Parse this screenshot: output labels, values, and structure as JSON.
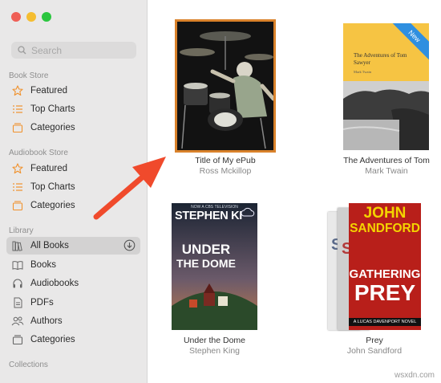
{
  "window": {
    "traffic_colors": [
      "#ef5f56",
      "#f5bd30",
      "#2bc63f"
    ]
  },
  "search": {
    "placeholder": "Search"
  },
  "sidebar": {
    "book_store": {
      "heading": "Book Store",
      "items": [
        {
          "label": "Featured",
          "icon": "star-icon"
        },
        {
          "label": "Top Charts",
          "icon": "list-icon"
        },
        {
          "label": "Categories",
          "icon": "shelf-box-icon"
        }
      ]
    },
    "audiobook_store": {
      "heading": "Audiobook Store",
      "items": [
        {
          "label": "Featured",
          "icon": "star-icon"
        },
        {
          "label": "Top Charts",
          "icon": "list-icon"
        },
        {
          "label": "Categories",
          "icon": "shelf-box-icon"
        }
      ]
    },
    "library": {
      "heading": "Library",
      "items": [
        {
          "label": "All Books",
          "icon": "books-icon",
          "selected": true
        },
        {
          "label": "Books",
          "icon": "open-book-icon"
        },
        {
          "label": "Audiobooks",
          "icon": "headphones-icon"
        },
        {
          "label": "PDFs",
          "icon": "document-icon"
        },
        {
          "label": "Authors",
          "icon": "people-icon"
        },
        {
          "label": "Categories",
          "icon": "shelf-box-icon"
        }
      ]
    },
    "collections": {
      "heading": "Collections"
    }
  },
  "books": [
    {
      "title": "Title of My ePub",
      "author": "Ross Mckillop",
      "selected": true
    },
    {
      "title": "The Adventures of Tom",
      "author": "Mark Twain",
      "cover_title": "The Adventures of Tom Sawyer",
      "cover_author": "Mark Twain",
      "badge": "New"
    },
    {
      "title": "Under the Dome",
      "author": "Stephen King",
      "cover_author": "STEPHEN KI",
      "cover_title_1": "UNDER",
      "cover_title_2": "THE DOME",
      "cover_note": "NOW A CBS TELEVISION"
    },
    {
      "title": "Prey",
      "author": "John Sandford",
      "cover_author_1": "JOHN",
      "cover_author_2": "SANDFORD",
      "cover_title_1": "GATHERING",
      "cover_title_2": "PREY",
      "cover_tagline": "A LUCAS DAVENPORT NOVEL",
      "spine_letters": [
        "S",
        "S"
      ]
    }
  ],
  "colors": {
    "accent": "#f0922e",
    "arrow": "#f04a2c",
    "selection_border": "#d9822b"
  },
  "watermark": "wsxdn.com"
}
